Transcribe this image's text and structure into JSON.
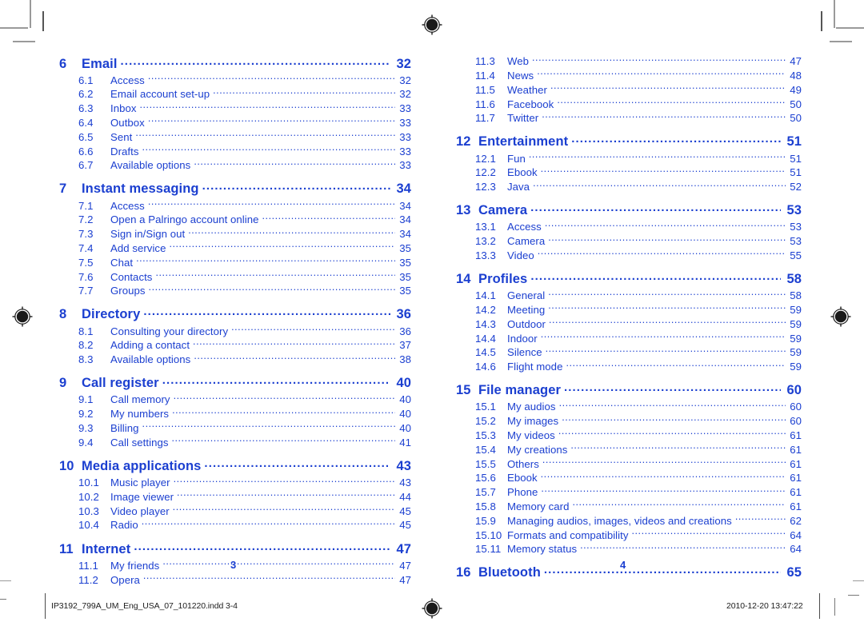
{
  "document": {
    "type": "table-of-contents",
    "accent_color": "#1b3fd0",
    "left_page_folio": "3",
    "right_page_folio": "4"
  },
  "footer": {
    "filename": "IP3192_799A_UM_Eng_USA_07_101220.indd   3-4",
    "timestamp": "2010-12-20   13:47:22"
  },
  "toc": {
    "left_column": [
      {
        "level": 1,
        "num": "6",
        "title": "Email",
        "page": "32"
      },
      {
        "level": 2,
        "num": "6.1",
        "title": "Access",
        "page": "32"
      },
      {
        "level": 2,
        "num": "6.2",
        "title": "Email account set-up",
        "page": "32"
      },
      {
        "level": 2,
        "num": "6.3",
        "title": "Inbox",
        "page": "33"
      },
      {
        "level": 2,
        "num": "6.4",
        "title": "Outbox",
        "page": "33"
      },
      {
        "level": 2,
        "num": "6.5",
        "title": "Sent",
        "page": "33"
      },
      {
        "level": 2,
        "num": "6.6",
        "title": "Drafts",
        "page": "33"
      },
      {
        "level": 2,
        "num": "6.7",
        "title": "Available options",
        "page": "33"
      },
      {
        "level": 1,
        "num": "7",
        "title": "Instant messaging",
        "page": "34"
      },
      {
        "level": 2,
        "num": "7.1",
        "title": "Access",
        "page": "34"
      },
      {
        "level": 2,
        "num": "7.2",
        "title": "Open a Palringo account online",
        "page": "34"
      },
      {
        "level": 2,
        "num": "7.3",
        "title": "Sign in/Sign out",
        "page": "34"
      },
      {
        "level": 2,
        "num": "7.4",
        "title": "Add service",
        "page": "35"
      },
      {
        "level": 2,
        "num": "7.5",
        "title": "Chat",
        "page": "35"
      },
      {
        "level": 2,
        "num": "7.6",
        "title": "Contacts",
        "page": "35"
      },
      {
        "level": 2,
        "num": "7.7",
        "title": "Groups",
        "page": "35"
      },
      {
        "level": 1,
        "num": "8",
        "title": "Directory",
        "page": "36"
      },
      {
        "level": 2,
        "num": "8.1",
        "title": "Consulting your directory",
        "page": "36"
      },
      {
        "level": 2,
        "num": "8.2",
        "title": "Adding a contact",
        "page": "37"
      },
      {
        "level": 2,
        "num": "8.3",
        "title": "Available options",
        "page": "38"
      },
      {
        "level": 1,
        "num": "9",
        "title": "Call register",
        "page": "40"
      },
      {
        "level": 2,
        "num": "9.1",
        "title": "Call memory",
        "page": "40"
      },
      {
        "level": 2,
        "num": "9.2",
        "title": "My numbers",
        "page": "40"
      },
      {
        "level": 2,
        "num": "9.3",
        "title": "Billing",
        "page": "40"
      },
      {
        "level": 2,
        "num": "9.4",
        "title": "Call settings",
        "page": "41"
      },
      {
        "level": 1,
        "num": "10",
        "title": "Media applications",
        "page": "43"
      },
      {
        "level": 2,
        "num": "10.1",
        "title": "Music player",
        "page": "43"
      },
      {
        "level": 2,
        "num": "10.2",
        "title": "Image viewer",
        "page": "44"
      },
      {
        "level": 2,
        "num": "10.3",
        "title": "Video player",
        "page": "45"
      },
      {
        "level": 2,
        "num": "10.4",
        "title": "Radio",
        "page": "45"
      },
      {
        "level": 1,
        "num": "11",
        "title": "Internet",
        "page": "47"
      },
      {
        "level": 2,
        "num": "11.1",
        "title": "My friends",
        "page": "47"
      },
      {
        "level": 2,
        "num": "11.2",
        "title": "Opera",
        "page": "47"
      }
    ],
    "right_column": [
      {
        "level": 2,
        "num": "11.3",
        "title": "Web",
        "page": "47"
      },
      {
        "level": 2,
        "num": "11.4",
        "title": "News",
        "page": "48"
      },
      {
        "level": 2,
        "num": "11.5",
        "title": "Weather",
        "page": "49"
      },
      {
        "level": 2,
        "num": "11.6",
        "title": "Facebook",
        "page": "50"
      },
      {
        "level": 2,
        "num": "11.7",
        "title": "Twitter",
        "page": "50"
      },
      {
        "level": 1,
        "num": "12",
        "title": "Entertainment",
        "page": "51"
      },
      {
        "level": 2,
        "num": "12.1",
        "title": "Fun",
        "page": "51"
      },
      {
        "level": 2,
        "num": "12.2",
        "title": "Ebook",
        "page": "51"
      },
      {
        "level": 2,
        "num": "12.3",
        "title": "Java",
        "page": "52"
      },
      {
        "level": 1,
        "num": "13",
        "title": "Camera",
        "page": "53"
      },
      {
        "level": 2,
        "num": "13.1",
        "title": "Access",
        "page": "53"
      },
      {
        "level": 2,
        "num": "13.2",
        "title": "Camera",
        "page": "53"
      },
      {
        "level": 2,
        "num": "13.3",
        "title": "Video",
        "page": "55"
      },
      {
        "level": 1,
        "num": "14",
        "title": "Profiles",
        "page": "58"
      },
      {
        "level": 2,
        "num": "14.1",
        "title": "General",
        "page": "58"
      },
      {
        "level": 2,
        "num": "14.2",
        "title": "Meeting",
        "page": "59"
      },
      {
        "level": 2,
        "num": "14.3",
        "title": "Outdoor",
        "page": "59"
      },
      {
        "level": 2,
        "num": "14.4",
        "title": "Indoor",
        "page": "59"
      },
      {
        "level": 2,
        "num": "14.5",
        "title": "Silence",
        "page": "59"
      },
      {
        "level": 2,
        "num": "14.6",
        "title": "Flight mode",
        "page": "59"
      },
      {
        "level": 1,
        "num": "15",
        "title": "File manager",
        "page": "60"
      },
      {
        "level": 2,
        "num": "15.1",
        "title": "My audios",
        "page": "60"
      },
      {
        "level": 2,
        "num": "15.2",
        "title": "My images",
        "page": "60"
      },
      {
        "level": 2,
        "num": "15.3",
        "title": "My videos",
        "page": "61"
      },
      {
        "level": 2,
        "num": "15.4",
        "title": "My creations",
        "page": "61"
      },
      {
        "level": 2,
        "num": "15.5",
        "title": "Others",
        "page": "61"
      },
      {
        "level": 2,
        "num": "15.6",
        "title": "Ebook",
        "page": "61"
      },
      {
        "level": 2,
        "num": "15.7",
        "title": "Phone",
        "page": "61"
      },
      {
        "level": 2,
        "num": "15.8",
        "title": "Memory card",
        "page": "61"
      },
      {
        "level": 2,
        "num": "15.9",
        "title": "Managing audios, images, videos and creations",
        "page": "62"
      },
      {
        "level": 2,
        "num": "15.10",
        "title": "Formats and compatibility",
        "page": "64"
      },
      {
        "level": 2,
        "num": "15.11",
        "title": "Memory status",
        "page": "64"
      },
      {
        "level": 1,
        "num": "16",
        "title": "Bluetooth",
        "page": "65"
      }
    ]
  }
}
